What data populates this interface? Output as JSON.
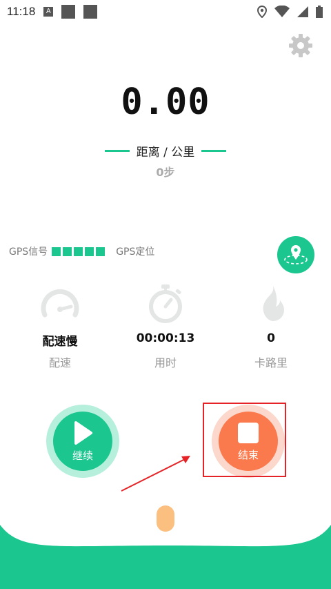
{
  "status_bar": {
    "time": "11:18",
    "notification_icon_letter": "A",
    "icons": [
      "location-icon",
      "wifi-icon",
      "signal-icon",
      "battery-icon"
    ]
  },
  "header": {
    "settings_icon": "gear-icon"
  },
  "distance": {
    "value": "0.00",
    "label": "距离 / 公里",
    "steps": "0步"
  },
  "gps": {
    "signal_label": "GPS信号",
    "signal_strength_bars": 5,
    "locate_label": "GPS定位",
    "locate_icon": "map-pin-icon"
  },
  "stats": [
    {
      "icon": "speedometer-icon",
      "value": "配速慢",
      "label": "配速"
    },
    {
      "icon": "stopwatch-icon",
      "value": "00:00:13",
      "label": "用时"
    },
    {
      "icon": "flame-icon",
      "value": "0",
      "label": "卡路里"
    }
  ],
  "controls": {
    "continue_label": "继续",
    "end_label": "结束"
  },
  "colors": {
    "accent_green": "#1bc68f",
    "accent_orange": "#fb7a4d",
    "highlight_red": "#e52326",
    "lock_pill": "#fbbf7f"
  }
}
